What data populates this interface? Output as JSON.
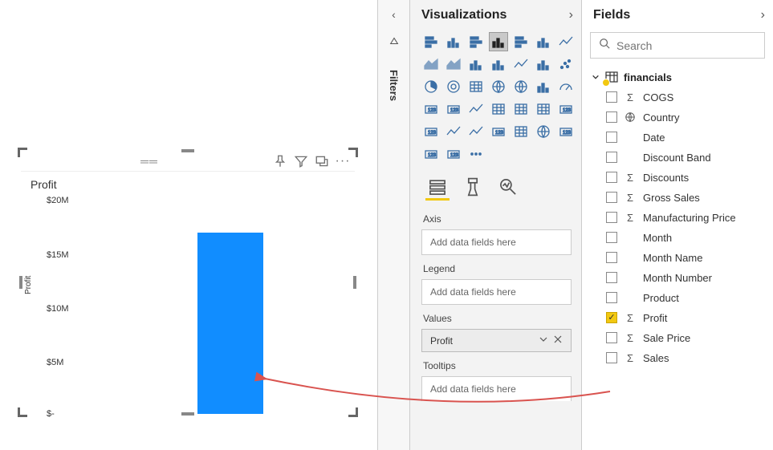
{
  "chart_data": {
    "type": "bar",
    "categories": [
      ""
    ],
    "values": [
      17000000
    ],
    "title": "Profit",
    "xlabel": "",
    "ylabel": "Profit",
    "ylim": [
      0,
      20000000
    ],
    "y_ticks": [
      "$20M",
      "$15M",
      "$10M",
      "$5M",
      "$-"
    ]
  },
  "tile": {
    "actions": {
      "pin": "📌",
      "filter": "⧩",
      "focus": "⛶",
      "more": "···"
    },
    "grip": "══"
  },
  "filters_rail": {
    "label": "Filters",
    "expand": "‹",
    "sort": "⊿"
  },
  "viz_pane": {
    "title": "Visualizations",
    "axis_label": "Axis",
    "axis_placeholder": "Add data fields here",
    "legend_label": "Legend",
    "legend_placeholder": "Add data fields here",
    "values_label": "Values",
    "values_field": "Profit",
    "tooltips_label": "Tooltips",
    "tooltips_placeholder": "Add data fields here",
    "grid_names": [
      "stacked-bar-icon",
      "stacked-column-icon",
      "clustered-bar-icon",
      "clustered-column-icon",
      "hundred-stacked-bar-icon",
      "hundred-stacked-column-icon",
      "line-chart-icon",
      "area-chart-icon",
      "stacked-area-icon",
      "line-stacked-column-icon",
      "line-clustered-column-icon",
      "ribbon-chart-icon",
      "waterfall-icon",
      "scatter-chart-icon",
      "pie-chart-icon",
      "donut-chart-icon",
      "treemap-icon",
      "map-icon",
      "filled-map-icon",
      "funnel-icon",
      "gauge-icon",
      "card-icon",
      "multi-row-card-icon",
      "kpi-icon",
      "slicer-icon",
      "table-icon",
      "matrix-icon",
      "r-visual-icon",
      "py-visual-icon",
      "key-influencers-icon",
      "decomp-tree-icon",
      "qa-icon",
      "paginated-icon",
      "arcgis-icon",
      "powerapps-icon",
      "custom-visual-icon",
      "get-more-icon",
      "more-icon"
    ],
    "selected_index": 3
  },
  "fields_pane": {
    "title": "Fields",
    "search_placeholder": "Search",
    "table_name": "financials",
    "fields": [
      {
        "name": "COGS",
        "type": "sigma",
        "checked": false
      },
      {
        "name": "Country",
        "type": "globe",
        "checked": false
      },
      {
        "name": "Date",
        "type": "none",
        "checked": false
      },
      {
        "name": "Discount Band",
        "type": "none",
        "checked": false
      },
      {
        "name": "Discounts",
        "type": "sigma",
        "checked": false
      },
      {
        "name": "Gross Sales",
        "type": "sigma",
        "checked": false
      },
      {
        "name": "Manufacturing Price",
        "type": "sigma",
        "checked": false
      },
      {
        "name": "Month",
        "type": "none",
        "checked": false
      },
      {
        "name": "Month Name",
        "type": "none",
        "checked": false
      },
      {
        "name": "Month Number",
        "type": "none",
        "checked": false
      },
      {
        "name": "Product",
        "type": "none",
        "checked": false
      },
      {
        "name": "Profit",
        "type": "sigma",
        "checked": true
      },
      {
        "name": "Sale Price",
        "type": "sigma",
        "checked": false
      },
      {
        "name": "Sales",
        "type": "sigma",
        "checked": false
      }
    ]
  }
}
